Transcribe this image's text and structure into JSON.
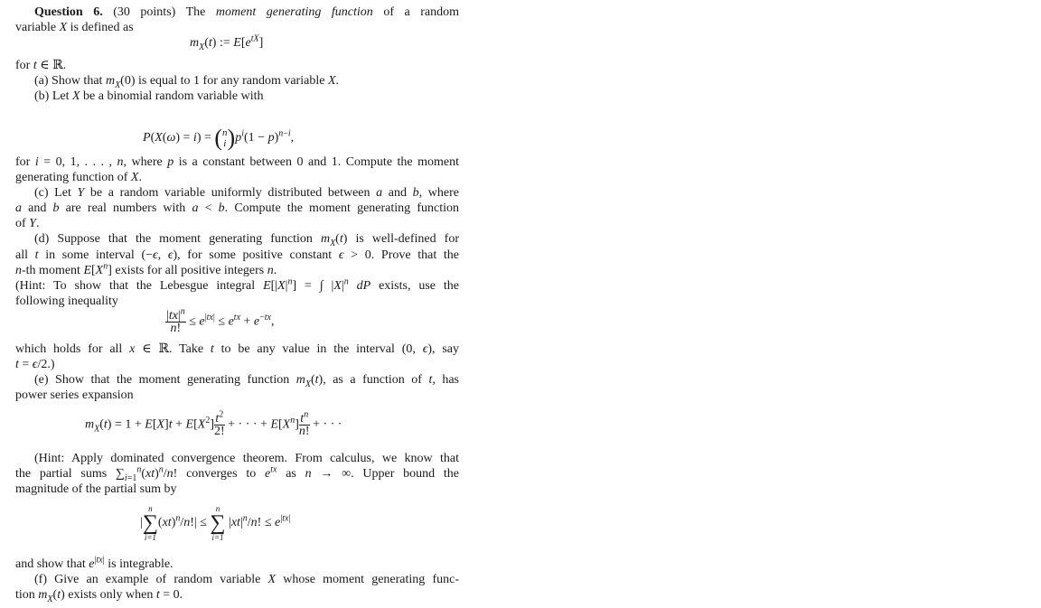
{
  "question": {
    "heading": "Question 6.",
    "points": "(30 points)",
    "intro_before": "The",
    "intro_term": "moment generating function",
    "intro_after": "of a random",
    "line2": "variable X is defined as",
    "definition": "m_X(t) := E[e^{tX}]",
    "domain_line": "for t ∈ ℝ."
  },
  "parts": {
    "a": {
      "label": "(a)",
      "text": "Show that m_X(0) is equal to 1 for any random variable X."
    },
    "b": {
      "label": "(b)",
      "text_intro": "Let X be a binomial random variable with",
      "formula": "P(X(ω) = i) = (n choose i) p^i (1 − p)^{n−i},",
      "line1": "for i = 0, 1, . . . , n, where p is a constant between 0 and 1. Compute the moment",
      "line2": "generating function of X."
    },
    "c": {
      "label": "(c)",
      "line1": "Let Y be a random variable uniformly distributed between a and b, where",
      "line2": "a and b are real numbers with a < b. Compute the moment generating function",
      "line3": "of Y."
    },
    "d": {
      "label": "(d)",
      "line1": "Suppose that the moment generating function m_X(t) is well-defined for",
      "line2": "all t in some interval (−ϵ, ϵ), for some positive constant ϵ > 0. Prove that the",
      "line3": "n-th moment E[X^n] exists for all positive integers n.",
      "hint1": "(Hint: To show that the Lebesgue integral E[|X|^n] = ∫ |X|^n dP exists, use the",
      "hint2": "following inequality",
      "inequality": "|tx|^n / n! ≤ e^{|tx|} ≤ e^{tx} + e^{−tx},",
      "after1": "which holds for all x ∈ ℝ. Take t to be any value in the interval (0, ϵ), say",
      "after2": "t = ϵ/2.)"
    },
    "e": {
      "label": "(e)",
      "line1": "Show that the moment generating function m_X(t), as a function of t, has",
      "line2": "power series expansion",
      "series": "m_X(t) = 1 + E[X]t + E[X^2] t^2/2! + · · · + E[X^n] t^n/n! + · · ·",
      "hint1": "(Hint: Apply dominated convergence theorem. From calculus, we know that",
      "hint2": "the partial sums Σ_{i=1}^n (xt)^n/n! converges to e^{tx} as n → ∞. Upper bound the",
      "hint3": "magnitude of the partial sum by",
      "bound": "|Σ_{i=1}^n (xt)^n/n!| ≤ Σ_{i=1}^n |xt|^n/n! ≤ e^{|tx|}",
      "after": "and show that e^{|tx|} is integrable."
    },
    "f": {
      "label": "(f)",
      "line1": "Give an example of random variable X whose moment generating func-",
      "line2": "tion m_X(t) exists only when t = 0."
    }
  }
}
